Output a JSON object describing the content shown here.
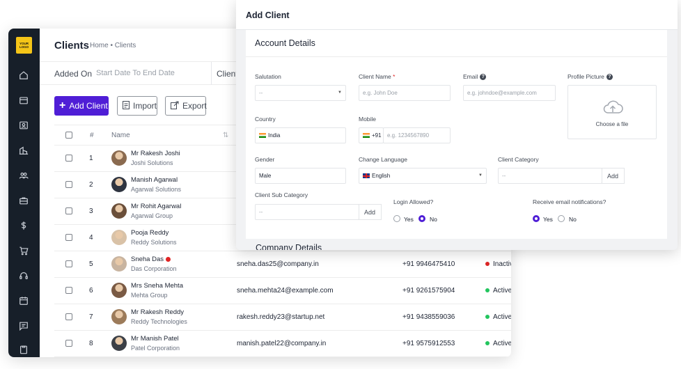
{
  "app": {
    "logo_text": "YOUR LOGO",
    "page_title": "Clients",
    "breadcrumb": "Home • Clients",
    "filter": {
      "label": "Added On",
      "value": "Start Date To End Date",
      "client_label": "Client"
    },
    "buttons": {
      "add": "Add Client",
      "import": "Import",
      "export": "Export"
    },
    "table": {
      "headers": {
        "index": "#",
        "name": "Name"
      },
      "rows": [
        {
          "num": "1",
          "name": "Mr Rakesh Joshi",
          "company": "Joshi Solutions",
          "email": "",
          "mobile": "",
          "status": ""
        },
        {
          "num": "2",
          "name": "Manish Agarwal",
          "company": "Agarwal Solutions",
          "email": "",
          "mobile": "",
          "status": ""
        },
        {
          "num": "3",
          "name": "Mr Rohit Agarwal",
          "company": "Agarwal Group",
          "email": "",
          "mobile": "",
          "status": ""
        },
        {
          "num": "4",
          "name": "Pooja Reddy",
          "company": "Reddy Solutions",
          "email": "",
          "mobile": "",
          "status": ""
        },
        {
          "num": "5",
          "name": "Sneha Das",
          "company": "Das Corporation",
          "email": "sneha.das25@company.in",
          "mobile": "+91 9946475410",
          "status": "Inactive"
        },
        {
          "num": "6",
          "name": "Mrs Sneha Mehta",
          "company": "Mehta Group",
          "email": "sneha.mehta24@example.com",
          "mobile": "+91 9261575904",
          "status": "Active"
        },
        {
          "num": "7",
          "name": "Mr Rakesh Reddy",
          "company": "Reddy Technologies",
          "email": "rakesh.reddy23@startup.net",
          "mobile": "+91 9438559036",
          "status": "Active"
        },
        {
          "num": "8",
          "name": "Mr Manish Patel",
          "company": "Patel Corporation",
          "email": "manish.patel22@company.in",
          "mobile": "+91 9575912553",
          "status": "Active"
        }
      ]
    }
  },
  "modal": {
    "title": "Add Client",
    "section_title": "Account Details",
    "next_section_title": "Company Details",
    "fields": {
      "salutation": {
        "label": "Salutation",
        "value": "--"
      },
      "client_name": {
        "label": "Client Name",
        "required_mark": "*",
        "placeholder": "e.g. John Doe"
      },
      "email": {
        "label": "Email",
        "placeholder": "e.g. johndoe@example.com"
      },
      "profile_picture": {
        "label": "Profile Picture",
        "upload_text": "Choose a file"
      },
      "country": {
        "label": "Country",
        "value": "India"
      },
      "mobile": {
        "label": "Mobile",
        "code": "+91",
        "placeholder": "e.g. 1234567890"
      },
      "gender": {
        "label": "Gender",
        "value": "Male"
      },
      "change_language": {
        "label": "Change Language",
        "value": "English"
      },
      "client_category": {
        "label": "Client Category",
        "value": "--",
        "add_label": "Add"
      },
      "client_sub_category": {
        "label": "Client Sub Category",
        "value": "--",
        "add_label": "Add"
      },
      "login_allowed": {
        "label": "Login Allowed?",
        "options": [
          "Yes",
          "No"
        ],
        "selected": "No"
      },
      "email_notifications": {
        "label": "Receive email notifications?",
        "options": [
          "Yes",
          "No"
        ],
        "selected": "Yes"
      }
    }
  },
  "colors": {
    "primary": "#4f1ed6",
    "sidebar": "#171f29",
    "logo": "#f5c518",
    "active": "#22c55e",
    "inactive": "#dc2626"
  }
}
